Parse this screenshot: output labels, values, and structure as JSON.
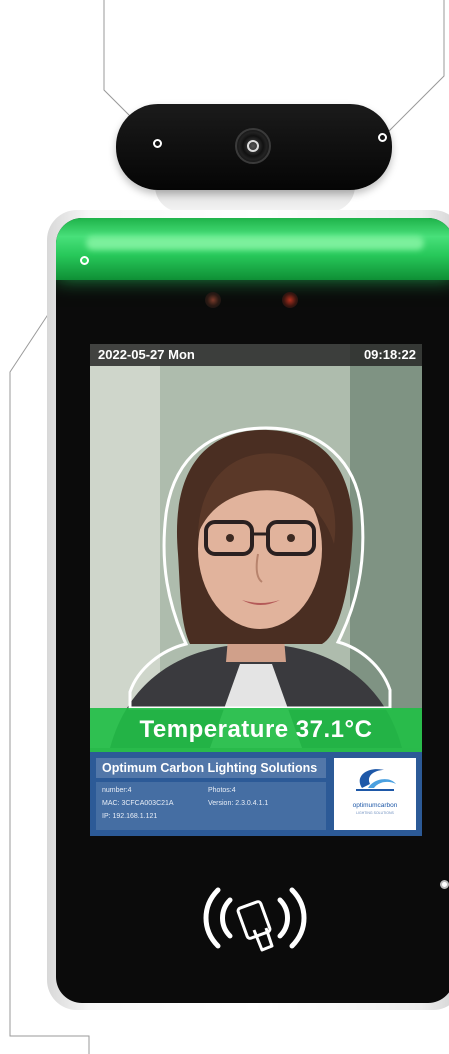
{
  "screen": {
    "status_bar": {
      "date": "2022-05-27 Mon",
      "time": "09:18:22"
    },
    "temperature": {
      "label": "Temperature 37.1°C"
    },
    "info": {
      "company": "Optimum Carbon Lighting Solutions",
      "number": "number:4",
      "mac": "MAC: 3CFCA003C21A",
      "ip": "IP: 192.168.1.121",
      "photos": "Photos:4",
      "version": "Version: 2.3.0.4.1.1"
    },
    "logo": {
      "text": "optimumcarbon",
      "subtext": "LIGHTING SOLUTIONS"
    }
  },
  "icons": [
    "camera-lens-icon",
    "face-outline-icon",
    "nfc-card-icon",
    "callout-dot-icon"
  ],
  "colors": {
    "light_bar": "#2fd45f",
    "temperature_band": "#22be46",
    "info_panel": "#2c5a97",
    "status_bar": "#282828",
    "device_body": "#0b0b0b"
  }
}
